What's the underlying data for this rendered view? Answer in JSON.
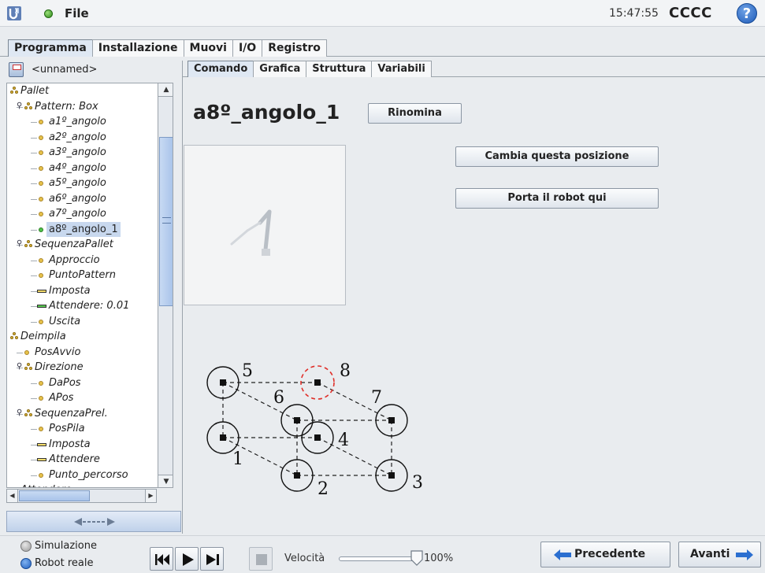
{
  "header": {
    "file_menu": "File",
    "time": "15:47:55",
    "robot_name": "CCCC",
    "help_label": "?"
  },
  "main_tabs": [
    "Programma",
    "Installazione",
    "Muovi",
    "I/O",
    "Registro"
  ],
  "program": {
    "name": "<unnamed>"
  },
  "tree": [
    {
      "label": "Pallet",
      "icon": "group-icon",
      "level": 0
    },
    {
      "label": "Pattern: Box",
      "icon": "group-icon",
      "level": 1
    },
    {
      "label": "a1º_angolo",
      "icon": "waypoint-icon",
      "level": 2
    },
    {
      "label": "a2º_angolo",
      "icon": "waypoint-icon",
      "level": 2
    },
    {
      "label": "a3º_angolo",
      "icon": "waypoint-icon",
      "level": 2
    },
    {
      "label": "a4º_angolo",
      "icon": "waypoint-icon",
      "level": 2
    },
    {
      "label": "a5º_angolo",
      "icon": "waypoint-icon",
      "level": 2
    },
    {
      "label": "a6º_angolo",
      "icon": "waypoint-icon",
      "level": 2
    },
    {
      "label": "a7º_angolo",
      "icon": "waypoint-icon",
      "level": 2
    },
    {
      "label": "a8º_angolo_1",
      "icon": "waypoint-icon",
      "level": 2,
      "selected": true
    },
    {
      "label": "SequenzaPallet",
      "icon": "group-icon",
      "level": 1
    },
    {
      "label": "Approccio",
      "icon": "waypoint-icon",
      "level": 2
    },
    {
      "label": "PuntoPattern",
      "icon": "waypoint-icon",
      "level": 2
    },
    {
      "label": "Imposta",
      "icon": "set-icon",
      "level": 2
    },
    {
      "label": "Attendere: 0.01",
      "icon": "wait-icon",
      "level": 2
    },
    {
      "label": "Uscita",
      "icon": "waypoint-icon",
      "level": 2
    },
    {
      "label": "Deimpila",
      "icon": "group-icon",
      "level": 0
    },
    {
      "label": "PosAvvio",
      "icon": "waypoint-icon",
      "level": 1
    },
    {
      "label": "Direzione",
      "icon": "group-icon",
      "level": 1
    },
    {
      "label": "DaPos",
      "icon": "waypoint-icon",
      "level": 2
    },
    {
      "label": "APos",
      "icon": "waypoint-icon",
      "level": 2
    },
    {
      "label": "SequenzaPrel.",
      "icon": "group-icon",
      "level": 1
    },
    {
      "label": "PosPila",
      "icon": "waypoint-icon",
      "level": 2
    },
    {
      "label": "Imposta",
      "icon": "set-icon",
      "level": 2
    },
    {
      "label": "Attendere",
      "icon": "set-icon",
      "level": 2
    },
    {
      "label": "Punto_percorso",
      "icon": "waypoint-icon",
      "level": 2
    },
    {
      "label": "Attendere",
      "icon": "set-icon",
      "level": 0
    }
  ],
  "sub_tabs": [
    "Comando",
    "Grafica",
    "Struttura",
    "Variabili"
  ],
  "command": {
    "title": "a8º_angolo_1",
    "rename_button": "Rinomina",
    "change_position_button": "Cambia questa posizione",
    "move_here_button": "Porta il robot qui"
  },
  "diagram_labels": [
    "1",
    "2",
    "3",
    "4",
    "5",
    "6",
    "7",
    "8"
  ],
  "footer": {
    "simulation_label": "Simulazione",
    "real_robot_label": "Robot reale",
    "speed_label": "Velocità",
    "speed_value": "100%",
    "speed_fraction": 1.0,
    "prev_button": "Precedente",
    "next_button": "Avanti"
  },
  "colors": {
    "accent_blue": "#1e5bb8",
    "status_green": "#2f8a1c",
    "selected_highlight": "#c8d8ee",
    "target_marker": "#e0302a"
  }
}
